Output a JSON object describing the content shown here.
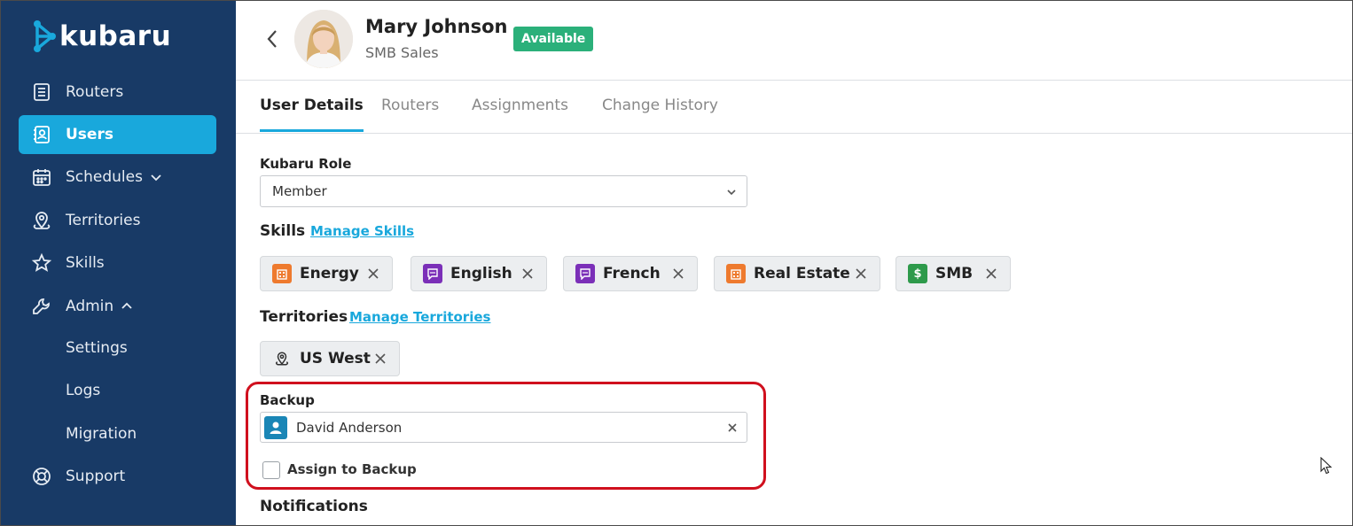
{
  "brand": {
    "name": "kubaru"
  },
  "sidebar": {
    "items": [
      {
        "label": "Routers"
      },
      {
        "label": "Users"
      },
      {
        "label": "Schedules"
      },
      {
        "label": "Territories"
      },
      {
        "label": "Skills"
      },
      {
        "label": "Admin"
      }
    ],
    "admin_sub": [
      {
        "label": "Settings"
      },
      {
        "label": "Logs"
      },
      {
        "label": "Migration"
      }
    ],
    "support": {
      "label": "Support"
    }
  },
  "user": {
    "name": "Mary Johnson",
    "role": "SMB Sales",
    "status": "Available"
  },
  "tabs": [
    {
      "label": "User Details"
    },
    {
      "label": "Routers"
    },
    {
      "label": "Assignments"
    },
    {
      "label": "Change History"
    }
  ],
  "details": {
    "role_label": "Kubaru Role",
    "role_value": "Member",
    "skills_title": "Skills",
    "manage_skills": "Manage Skills",
    "skills": [
      {
        "label": "Energy",
        "icon": "building-icon",
        "color": "#ee7a2e"
      },
      {
        "label": "English",
        "icon": "chat-icon",
        "color": "#7b2fb8"
      },
      {
        "label": "French",
        "icon": "chat-icon",
        "color": "#7b2fb8"
      },
      {
        "label": "Real Estate",
        "icon": "building-icon",
        "color": "#ee7a2e"
      },
      {
        "label": "SMB",
        "icon": "dollar-icon",
        "color": "#2e9a4b"
      }
    ],
    "territories_title": "Territories",
    "manage_territories": "Manage Territories",
    "territories": [
      {
        "label": "US West"
      }
    ],
    "backup_label": "Backup",
    "backup_value": "David Anderson",
    "assign_backup_label": "Assign to Backup",
    "notifications_title": "Notifications"
  },
  "colors": {
    "sidebar": "#183a66",
    "accent": "#19a8dc",
    "available": "#2bb07a",
    "highlight": "#d0101e"
  }
}
